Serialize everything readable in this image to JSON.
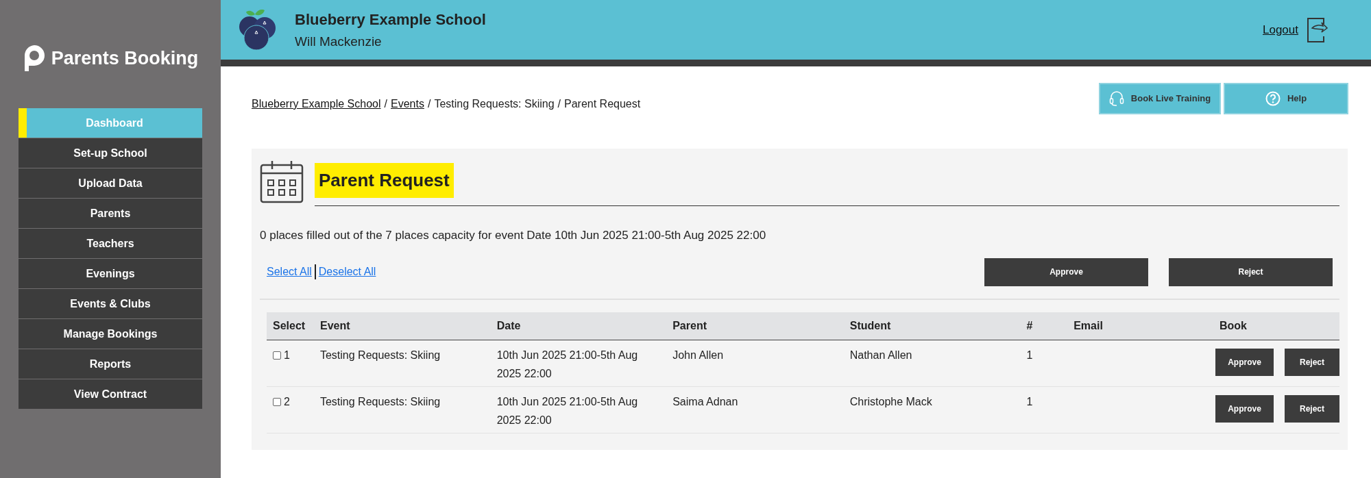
{
  "sidebar": {
    "brand": "Parents Booking",
    "items": [
      {
        "label": "Dashboard",
        "selected": true
      },
      {
        "label": "Set-up School",
        "selected": false
      },
      {
        "label": "Upload Data",
        "selected": false
      },
      {
        "label": "Parents",
        "selected": false
      },
      {
        "label": "Teachers",
        "selected": false
      },
      {
        "label": "Evenings",
        "selected": false
      },
      {
        "label": "Events & Clubs",
        "selected": false
      },
      {
        "label": "Manage Bookings",
        "selected": false
      },
      {
        "label": "Reports",
        "selected": false
      },
      {
        "label": "View Contract",
        "selected": false
      }
    ]
  },
  "header": {
    "school": "Blueberry Example School",
    "user": "Will Mackenzie",
    "logout": "Logout"
  },
  "breadcrumb_separator": "/",
  "breadcrumb": [
    {
      "label": "Blueberry Example School",
      "link": true
    },
    {
      "label": "Events",
      "link": true
    },
    {
      "label": "Testing Requests: Skiing",
      "link": false
    },
    {
      "label": "Parent Request",
      "link": false
    }
  ],
  "top_buttons": [
    {
      "label": "Book Live Training",
      "kind": "training"
    },
    {
      "label": "Help",
      "kind": "help"
    }
  ],
  "panel": {
    "title": "Parent Request",
    "capacity": "0 places filled out of the 7 places capacity for event Date 10th Jun 2025 21:00-5th Aug 2025 22:00",
    "select_all": "Select All",
    "deselect_all": "Deselect All",
    "bulk_buttons": [
      "Approve",
      "Reject"
    ]
  },
  "table": {
    "columns": [
      "Select",
      "Event",
      "Date",
      "Parent",
      "Student",
      "#",
      "Email",
      "Book"
    ],
    "rows": [
      {
        "checked": false,
        "number": "1",
        "event": "Testing Requests: Skiing",
        "date": "10th Jun 2025 21:00-5th Aug 2025 22:00",
        "parent": "John Allen",
        "student": "Nathan Allen",
        "count": "1",
        "buttons": [
          "Approve",
          "Reject"
        ]
      },
      {
        "checked": false,
        "number": "2",
        "event": "Testing Requests: Skiing",
        "date": "10th Jun 2025 21:00-5th Aug 2025 22:00",
        "parent": "Saima Adnan",
        "student": "Christophe Mack",
        "count": "1",
        "buttons": [
          "Approve",
          "Reject"
        ]
      }
    ]
  }
}
